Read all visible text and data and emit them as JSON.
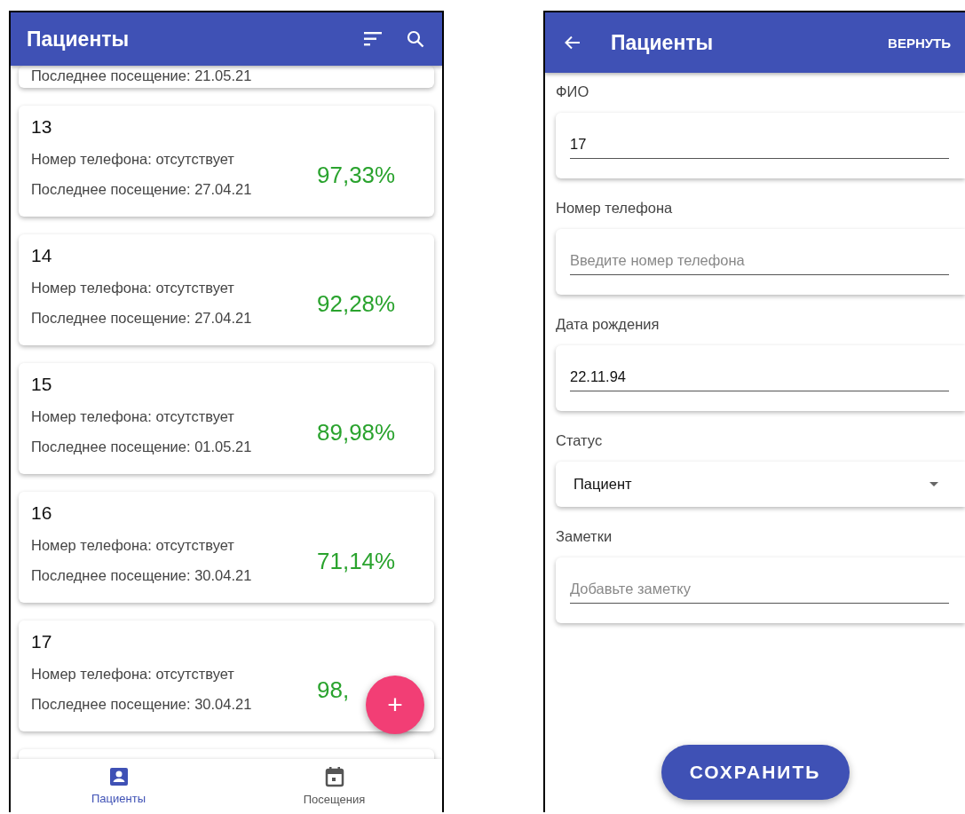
{
  "patients_screen": {
    "app_bar": {
      "title": "Пациенты"
    },
    "previous_card": {
      "last_visit": "Последнее посещение: 21.05.21"
    },
    "patients": [
      {
        "name": "13",
        "phone": "Номер телефона: отсутствует",
        "last_visit": "Последнее посещение: 27.04.21",
        "score": "97,33%"
      },
      {
        "name": "14",
        "phone": "Номер телефона: отсутствует",
        "last_visit": "Последнее посещение: 27.04.21",
        "score": "92,28%"
      },
      {
        "name": "15",
        "phone": "Номер телефона: отсутствует",
        "last_visit": "Последнее посещение: 01.05.21",
        "score": "89,98%"
      },
      {
        "name": "16",
        "phone": "Номер телефона: отсутствует",
        "last_visit": "Последнее посещение: 30.04.21",
        "score": "71,14%"
      },
      {
        "name": "17",
        "phone": "Номер телефона: отсутствует",
        "last_visit": "Последнее посещение: 30.04.21",
        "score": "98,"
      }
    ],
    "fab": "+",
    "bottom_nav": [
      {
        "label": "Пациенты",
        "kind": "person",
        "selected": true
      },
      {
        "label": "Посещения",
        "kind": "calendar",
        "selected": false
      }
    ]
  },
  "edit_screen": {
    "app_bar": {
      "title": "Пациенты",
      "action": "ВЕРНУТЬ"
    },
    "fields": [
      {
        "label": "ФИО",
        "kind": "text",
        "value": "17"
      },
      {
        "label": "Номер телефона",
        "kind": "text",
        "placeholder": "Введите номер телефона"
      },
      {
        "label": "Дата рождения",
        "kind": "text",
        "value": "22.11.94"
      },
      {
        "label": "Статус",
        "kind": "select",
        "value": "Пациент"
      },
      {
        "label": "Заметки",
        "kind": "text",
        "placeholder": "Добавьте заметку"
      }
    ],
    "save_button": "СОХРАНИТЬ"
  }
}
